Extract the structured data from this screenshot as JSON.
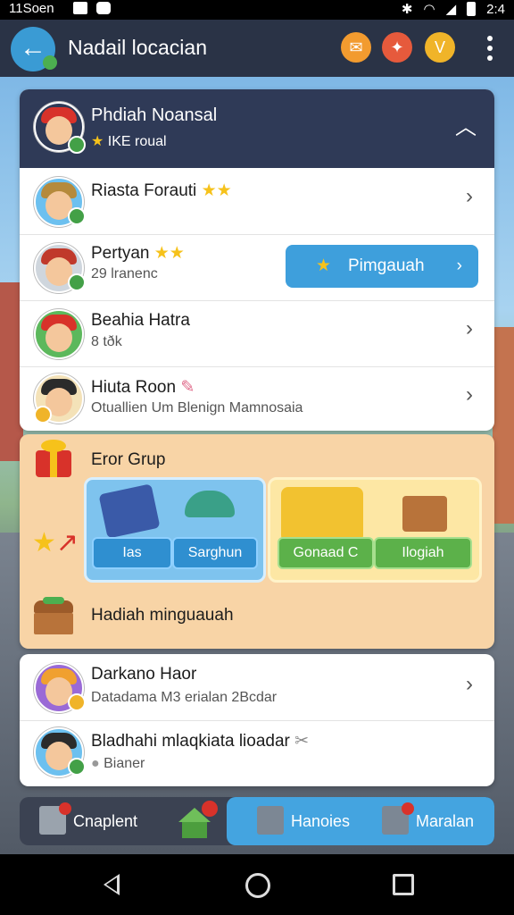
{
  "status_bar": {
    "time": "11Soen",
    "right_time": "2:4"
  },
  "app_bar": {
    "title": "Nadail locacian",
    "badge_text": "V"
  },
  "group": {
    "header": {
      "name": "Phdiah Noansal",
      "subtitle": "IKE roual"
    },
    "members": [
      {
        "name": "Riasta Forauti",
        "stars": "★★"
      },
      {
        "name": "Pertyan",
        "stars": "★★",
        "sub": "29 lranenc",
        "action_label": "Pimgauah"
      },
      {
        "name": "Beahia Hatra",
        "sub": "8 tðk"
      },
      {
        "name": "Hiuta Roon",
        "sub": "Otuallien Um  Blenign  Mamnosaia"
      }
    ]
  },
  "gift_section": {
    "title": "Eror Grup",
    "panel_a_buttons": [
      "Ias",
      "Sarghun"
    ],
    "panel_b_buttons": [
      "Gonaad C",
      "Ilogiah"
    ],
    "reward_label": "Hadiah minguauah"
  },
  "bottom_list": [
    {
      "name": "Darkano Haor",
      "sub": "Datadama M3 erialan  2Bcdar"
    },
    {
      "name": "Bladhahi mlaqkiata lioadar",
      "sub": "Bianer"
    }
  ],
  "tabs": [
    {
      "label": "Cnaplent"
    },
    {
      "label": "Hanoies"
    },
    {
      "label": "Maralan"
    }
  ],
  "colors": {
    "accent": "#3e9fdc",
    "header": "#2f3a57",
    "gift_bg": "#f8d4a6",
    "appbar": "#2a3346"
  }
}
